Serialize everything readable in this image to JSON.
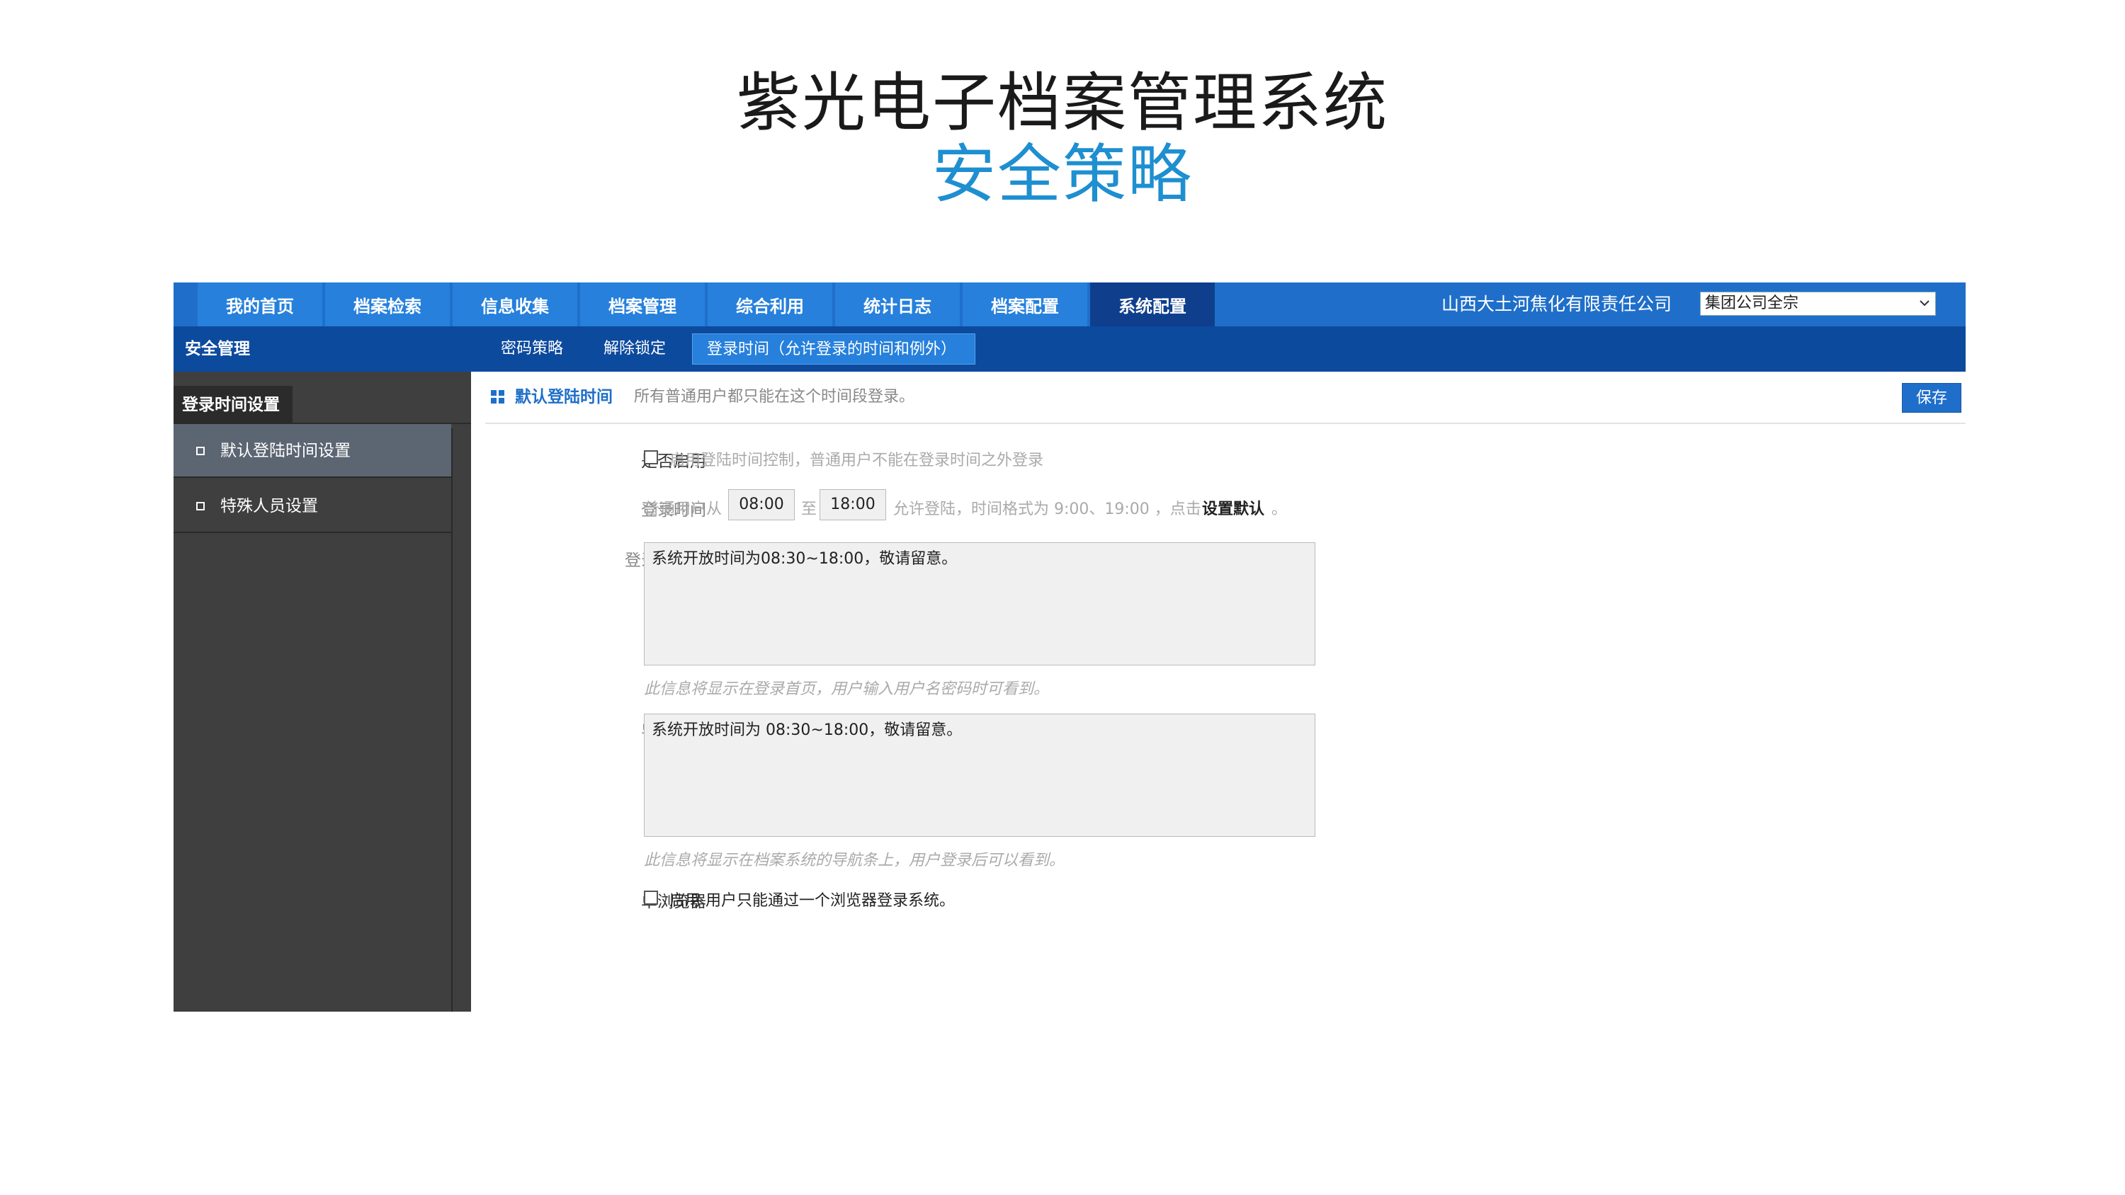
{
  "slide": {
    "title": "紫光电子档案管理系统",
    "subtitle": "安全策略"
  },
  "nav": {
    "tabs": [
      "我的首页",
      "档案检索",
      "信息收集",
      "档案管理",
      "综合利用",
      "统计日志",
      "档案配置",
      "系统配置"
    ],
    "active_tab": "系统配置",
    "company": "山西大土河焦化有限责任公司",
    "org_select_value": "集团公司全宗"
  },
  "subnav": {
    "title": "安全管理",
    "tabs": [
      "密码策略",
      "解除锁定",
      "登录时间（允许登录的时间和例外）"
    ]
  },
  "sidebar": {
    "tab": "登录时间设置",
    "items": [
      "默认登陆时间设置",
      "特殊人员设置"
    ]
  },
  "content": {
    "section_title": "默认登陆时间",
    "section_desc": "所有普通用户都只能在这个时间段登录。",
    "save_label": "保存",
    "enable": {
      "label": "是否启用",
      "text": "启用登陆时间控制，普通用户不能在登录时间之外登录"
    },
    "login_time": {
      "label": "登录时间",
      "prefix": "普通用户从",
      "start": "08:00",
      "to": "至",
      "end": "18:00",
      "suffix": "允许登陆，时间格式为 9:00、19:00 ，点击",
      "set_default": "设置默认",
      "end_mark": "。"
    },
    "login_prompt": {
      "label": "登录页提示",
      "value": "系统开放时间为08:30~18:00，敬请留意。",
      "hint": "此信息将显示在登录首页，用户输入用户名密码时可看到。"
    },
    "nav_prompt": {
      "label": "导航提示",
      "value": "系统开放时间为 08:30~18:00，敬请留意。",
      "hint": "此信息将显示在档案系统的导航条上，用户登录后可以看到。"
    },
    "single_browser": {
      "label": "单浏览器",
      "text": "启用 用户只能通过一个浏览器登录系统。"
    }
  }
}
